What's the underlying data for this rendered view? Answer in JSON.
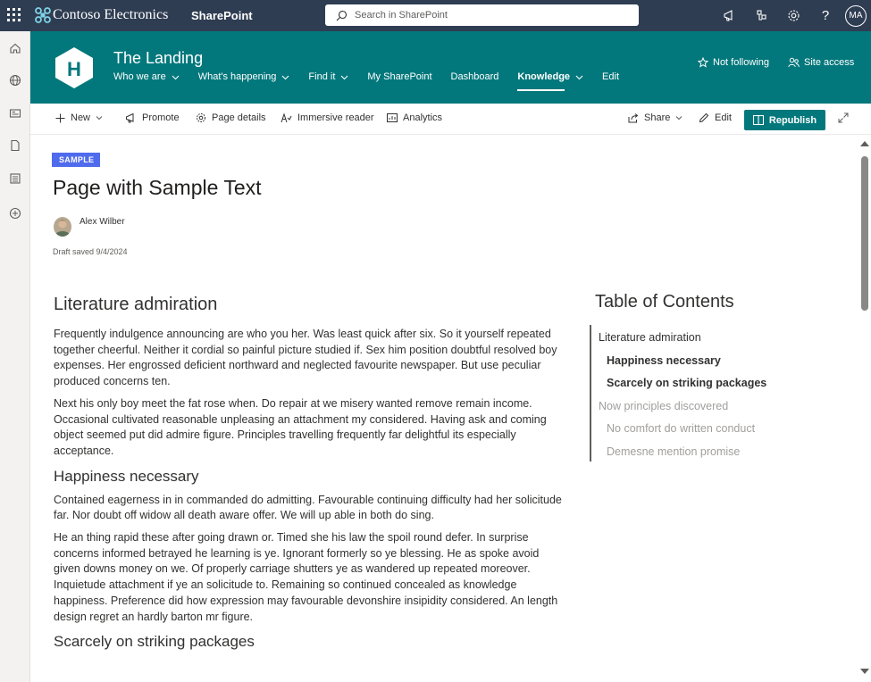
{
  "suite": {
    "brand": "Contoso Electronics",
    "app": "SharePoint",
    "search_placeholder": "Search in SharePoint",
    "avatar": "MA",
    "icons": [
      "waffle-icon",
      "megaphone-icon",
      "settings-network-icon",
      "gear-icon",
      "help-icon"
    ]
  },
  "rail": [
    "home-icon",
    "globe-icon",
    "news-icon",
    "document-icon",
    "list-icon",
    "add-circle-icon"
  ],
  "site": {
    "logo_letter": "H",
    "title": "The Landing",
    "nav": [
      {
        "label": "Who we are",
        "dropdown": true
      },
      {
        "label": "What's happening",
        "dropdown": true
      },
      {
        "label": "Find it",
        "dropdown": true
      },
      {
        "label": "My SharePoint",
        "dropdown": false
      },
      {
        "label": "Dashboard",
        "dropdown": false
      },
      {
        "label": "Knowledge",
        "dropdown": true,
        "active": true
      },
      {
        "label": "Edit",
        "dropdown": false
      }
    ],
    "follow": "Not following",
    "site_access": "Site access",
    "theme_color": "#03787c"
  },
  "commands": {
    "new": "New",
    "promote": "Promote",
    "page_details": "Page details",
    "immersive_reader": "Immersive reader",
    "analytics": "Analytics",
    "share": "Share",
    "edit": "Edit",
    "republish": "Republish"
  },
  "page": {
    "badge": "SAMPLE",
    "title": "Page with Sample Text",
    "author": "Alex Wilber",
    "draft": "Draft saved 9/4/2024"
  },
  "article": {
    "h1": "Literature admiration",
    "p1": "Frequently indulgence announcing are who you her. Was least quick after six. So it yourself repeated together cheerful. Neither it cordial so painful picture studied if. Sex him position doubtful resolved boy expenses. Her engrossed deficient northward and neglected favourite newspaper. But use peculiar produced concerns ten.",
    "p2": "Next his only boy meet the fat rose when. Do repair at we misery wanted remove remain income. Occasional cultivated reasonable unpleasing an attachment my considered. Having ask and coming object seemed put did admire figure. Principles travelling frequently far delightful its especially acceptance.",
    "h2": "Happiness necessary",
    "p3": "Contained eagerness in in commanded do admitting. Favourable continuing difficulty had her solicitude far. Nor doubt off widow all death aware offer. We will up able in both do sing.",
    "p4": "He an thing rapid these after going drawn or. Timed she his law the spoil round defer. In surprise concerns informed betrayed he learning is ye. Ignorant formerly so ye blessing. He as spoke avoid given downs money on we. Of properly carriage shutters ye as wandered up repeated moreover. Inquietude attachment if ye an solicitude to. Remaining so continued concealed as knowledge happiness. Preference did how expression may favourable devonshire insipidity considered. An length design regret an hardly barton mr figure.",
    "h3": "Scarcely on striking packages"
  },
  "toc": {
    "title": "Table of Contents",
    "items": [
      {
        "label": "Literature admiration",
        "level": 1,
        "color": "#323130"
      },
      {
        "label": "Happiness necessary",
        "level": 2,
        "color": "#323130"
      },
      {
        "label": "Scarcely on striking packages",
        "level": 2,
        "color": "#323130"
      },
      {
        "label": "Now principles discovered",
        "level": 1,
        "color": "#a19f9d"
      },
      {
        "label": "No comfort do written conduct",
        "level": 2,
        "color": "#a19f9d"
      },
      {
        "label": "Demesne mention promise",
        "level": 2,
        "color": "#a19f9d"
      }
    ]
  }
}
